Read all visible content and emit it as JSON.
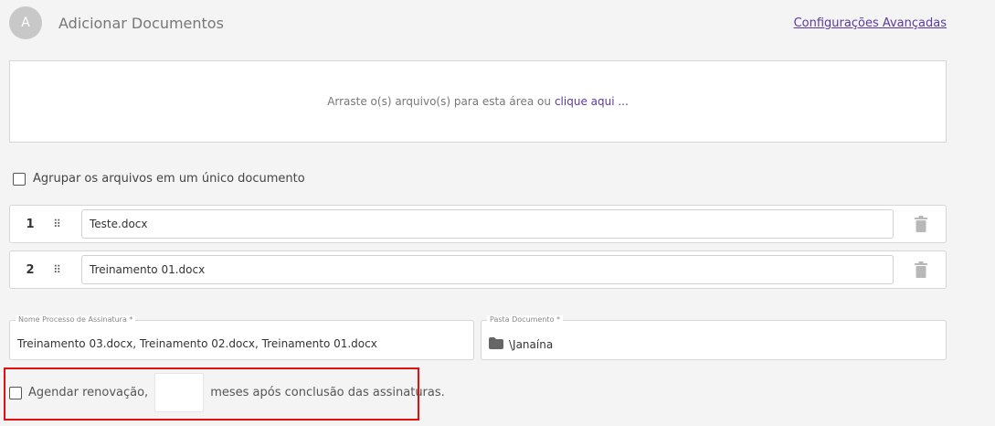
{
  "header": {
    "step_letter": "A",
    "title": "Adicionar Documentos",
    "advanced_link": "Configurações Avançadas"
  },
  "dropzone": {
    "text": "Arraste o(s) arquivo(s) para esta área ou",
    "link": "clique aqui ..."
  },
  "group_option": {
    "label": "Agrupar os arquivos em um único documento",
    "checked": false
  },
  "files": [
    {
      "index": "1",
      "name": "Teste.docx"
    },
    {
      "index": "2",
      "name": "Treinamento 01.docx"
    }
  ],
  "process_name": {
    "label": "Nome Processo de Assinatura *",
    "value": "Treinamento 03.docx, Treinamento 02.docx, Treinamento 01.docx"
  },
  "folder": {
    "label": "Pasta Documento *",
    "value": "\\Janaína",
    "icon": "folder-icon"
  },
  "renewal": {
    "label_before": "Agendar renovação,",
    "months_value": "",
    "label_after": "meses após conclusão das assinaturas.",
    "checked": false
  },
  "colors": {
    "accent": "#5b3a9e",
    "highlight_border": "#e01010",
    "trash_icon": "#b8b8b8"
  }
}
